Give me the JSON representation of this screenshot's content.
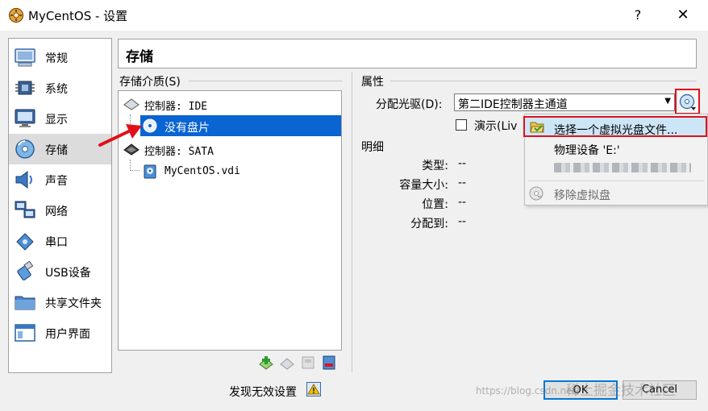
{
  "window": {
    "title": "MyCentOS - 设置",
    "help": "?",
    "close": "✕"
  },
  "nav": {
    "items": [
      {
        "label": "常规",
        "icon": "general-icon"
      },
      {
        "label": "系统",
        "icon": "system-chip-icon"
      },
      {
        "label": "显示",
        "icon": "monitor-icon"
      },
      {
        "label": "存储",
        "icon": "storage-disk-icon",
        "selected": true
      },
      {
        "label": "声音",
        "icon": "speaker-icon"
      },
      {
        "label": "网络",
        "icon": "network-icon"
      },
      {
        "label": "串口",
        "icon": "serial-port-icon"
      },
      {
        "label": "USB设备",
        "icon": "usb-icon"
      },
      {
        "label": "共享文件夹",
        "icon": "shared-folder-icon"
      },
      {
        "label": "用户界面",
        "icon": "user-interface-icon"
      }
    ]
  },
  "header": {
    "title": "存储"
  },
  "storage": {
    "media_label": "存储介质(S)",
    "tree": [
      {
        "label": "控制器: IDE",
        "type": "controller"
      },
      {
        "label": "没有盘片",
        "type": "optical-empty",
        "selected": true
      },
      {
        "label": "控制器: SATA",
        "type": "controller"
      },
      {
        "label": "MyCentOS.vdi",
        "type": "hard-disk"
      }
    ]
  },
  "attributes": {
    "label": "属性",
    "drive_label": "分配光驱(D):",
    "drive_value": "第二IDE控制器主通道",
    "live_label": "演示(Liv",
    "live_checked": false
  },
  "details": {
    "label": "明细",
    "rows": [
      {
        "key": "类型:",
        "value": "--"
      },
      {
        "key": "容量大小:",
        "value": "--"
      },
      {
        "key": "位置:",
        "value": "--"
      },
      {
        "key": "分配到:",
        "value": "--"
      }
    ]
  },
  "menu": {
    "choose": "选择一个虚拟光盘文件...",
    "physical": "物理设备 'E:'",
    "blurred": "",
    "remove": "移除虚拟盘"
  },
  "footer": {
    "invalid_settings": "发现无效设置",
    "ok": "OK",
    "cancel": "Cancel",
    "watermark": "https://blog.csdn.net/",
    "watermark2": "稀土掘金技术社区"
  },
  "colors": {
    "selection": "#0a64d2",
    "highlight_box": "#e0101a",
    "ok_border": "#0078d7"
  }
}
